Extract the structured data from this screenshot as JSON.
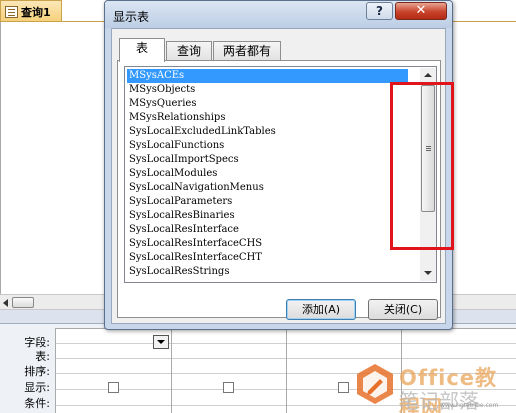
{
  "background": {
    "doc_tab_label": "查询1",
    "grid_row_labels": [
      "字段:",
      "表:",
      "排序:",
      "显示:",
      "条件:"
    ]
  },
  "dialog": {
    "title": "显示表",
    "help_label": "?",
    "close_label": "✕",
    "tabs": [
      {
        "label": "表",
        "active": true
      },
      {
        "label": "查询",
        "active": false
      },
      {
        "label": "两者都有",
        "active": false
      }
    ],
    "tables": [
      "MSysACEs",
      "MSysObjects",
      "MSysQueries",
      "MSysRelationships",
      "SysLocalExcludedLinkTables",
      "SysLocalFunctions",
      "SysLocalImportSpecs",
      "SysLocalModules",
      "SysLocalNavigationMenus",
      "SysLocalParameters",
      "SysLocalResBinaries",
      "SysLocalResInterface",
      "SysLocalResInterfaceCHS",
      "SysLocalResInterfaceCHT",
      "SysLocalResStrings"
    ],
    "selected_index": 0,
    "add_button_label": "添加(A)",
    "close_button_label": "关闭(C)"
  },
  "watermark": {
    "line1": "Office教程网",
    "line2": "笔记部落",
    "url": "www.notetribe.com"
  },
  "colors": {
    "selection": "#3399ff",
    "highlight_box": "#e0141a",
    "close_button": "#c8432b"
  }
}
